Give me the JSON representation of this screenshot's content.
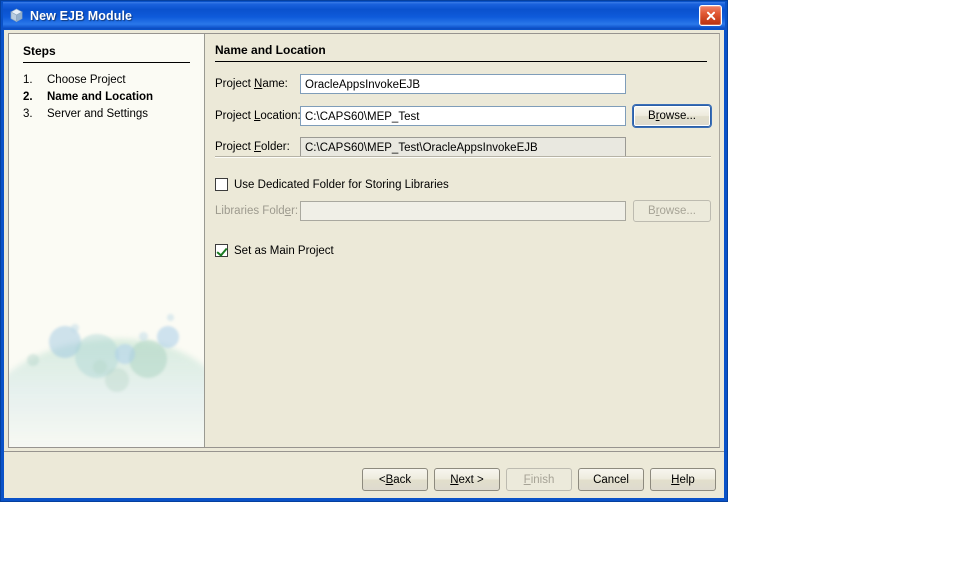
{
  "window": {
    "title": "New EJB Module",
    "icon": "module-cube-icon",
    "close_label": "Close",
    "titlebar_color": "#0a52ce",
    "dialog_background": "#ece9d8"
  },
  "steps_panel": {
    "heading": "Steps",
    "items": [
      {
        "number": "1.",
        "label": "Choose Project",
        "current": false
      },
      {
        "number": "2.",
        "label": "Name and Location",
        "current": true
      },
      {
        "number": "3.",
        "label": "Server and Settings",
        "current": false
      }
    ]
  },
  "main_panel": {
    "section_title": "Name and Location",
    "fields": [
      {
        "label_before": "Project ",
        "label_mnemonic": "N",
        "label_after": "ame:",
        "value": "OracleAppsInvokeEJB",
        "readonly": false,
        "disabled": false
      },
      {
        "label_before": "Project ",
        "label_mnemonic": "L",
        "label_after": "ocation:",
        "value": "C:\\CAPS60\\MEP_Test",
        "readonly": false,
        "disabled": false
      },
      {
        "label_before": "Project ",
        "label_mnemonic": "F",
        "label_after": "older:",
        "value": "C:\\CAPS60\\MEP_Test\\OracleAppsInvokeEJB",
        "readonly": true,
        "disabled": false
      }
    ],
    "browse_location": {
      "label_before": "B",
      "label_mnemonic": "r",
      "label_after": "owse...",
      "focused": true,
      "disabled": false
    },
    "dedicated_folder_checkbox": {
      "label": "Use Dedicated Folder for Storing Libraries",
      "checked": false
    },
    "libraries_folder": {
      "label_before": "Libraries Fold",
      "label_mnemonic": "e",
      "label_after": "r:",
      "value": "",
      "disabled": true
    },
    "browse_libraries": {
      "label_before": "B",
      "label_mnemonic": "r",
      "label_after": "owse...",
      "focused": false,
      "disabled": true
    },
    "main_project_checkbox": {
      "label": "Set as Main Project",
      "checked": true
    }
  },
  "buttons": {
    "back": {
      "before": "< ",
      "mnemonic": "B",
      "after": "ack",
      "disabled": false
    },
    "next": {
      "before": "",
      "mnemonic": "N",
      "after": "ext >",
      "disabled": false
    },
    "finish": {
      "before": "",
      "mnemonic": "F",
      "after": "inish",
      "disabled": true
    },
    "cancel": {
      "before": "Cancel",
      "mnemonic": "",
      "after": "",
      "disabled": false
    },
    "help": {
      "before": "",
      "mnemonic": "H",
      "after": "elp",
      "disabled": false
    }
  }
}
